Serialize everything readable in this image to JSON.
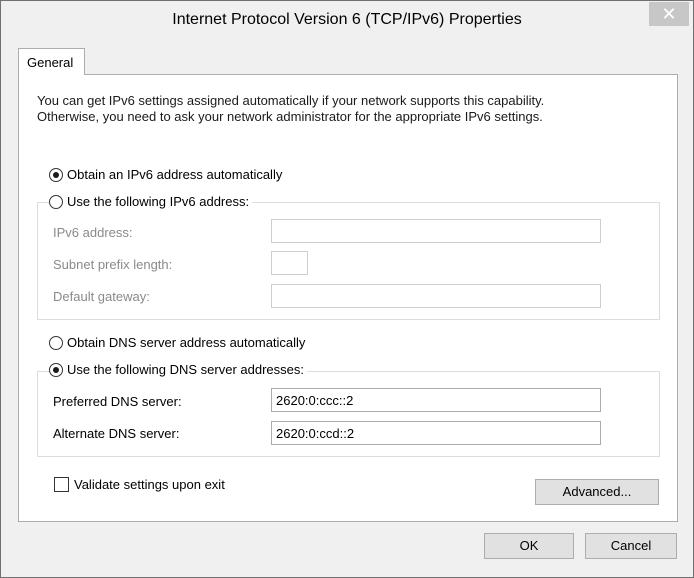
{
  "window": {
    "title": "Internet Protocol Version 6 (TCP/IPv6) Properties",
    "close_glyph": "✕"
  },
  "tabs": [
    {
      "label": "General",
      "selected": true
    }
  ],
  "intro": {
    "line1": "You can get IPv6 settings assigned automatically if your network supports this capability.",
    "line2": "Otherwise, you need to ask your network administrator for the appropriate IPv6 settings."
  },
  "ip_section": {
    "auto_label": "Obtain an IPv6 address automatically",
    "auto_selected": true,
    "manual_label": "Use the following IPv6 address:",
    "manual_selected": false,
    "fields": {
      "ipv6_address_label": "IPv6 address:",
      "ipv6_address_value": "",
      "subnet_prefix_label": "Subnet prefix length:",
      "subnet_prefix_value": "",
      "gateway_label": "Default gateway:",
      "gateway_value": ""
    }
  },
  "dns_section": {
    "auto_label": "Obtain DNS server address automatically",
    "auto_selected": false,
    "manual_label": "Use the following DNS server addresses:",
    "manual_selected": true,
    "fields": {
      "preferred_label": "Preferred DNS server:",
      "preferred_value": "2620:0:ccc::2",
      "alternate_label": "Alternate DNS server:",
      "alternate_value": "2620:0:ccd::2"
    }
  },
  "validate": {
    "label": "Validate settings upon exit",
    "checked": false
  },
  "buttons": {
    "advanced": "Advanced...",
    "ok": "OK",
    "cancel": "Cancel"
  },
  "colors": {
    "window_bg": "#f0f0f0",
    "panel_bg": "#ffffff",
    "disabled_text": "#8a8a8a",
    "button_bg": "#e1e1e1",
    "close_button_bg": "#c7c7c7"
  }
}
